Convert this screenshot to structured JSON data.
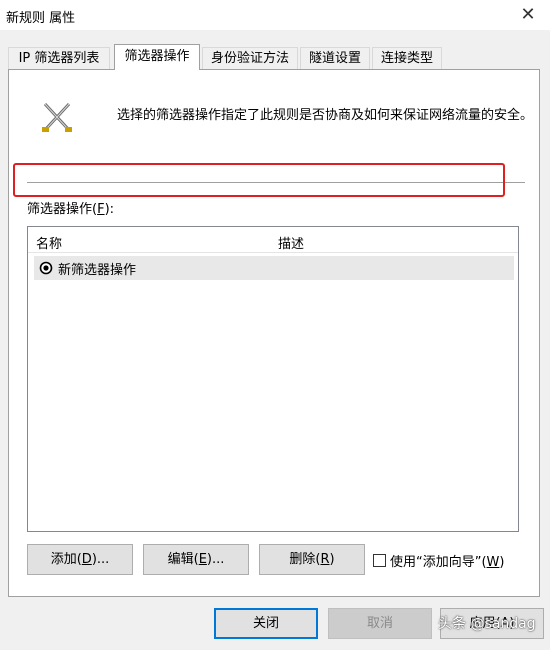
{
  "window": {
    "title": "新规则 属性",
    "close_glyph": "✕"
  },
  "tabs": [
    {
      "label": "IP 筛选器列表",
      "active": false
    },
    {
      "label": "筛选器操作",
      "active": true
    },
    {
      "label": "身份验证方法",
      "active": false
    },
    {
      "label": "隧道设置",
      "active": false
    },
    {
      "label": "连接类型",
      "active": false
    }
  ],
  "panel": {
    "icon": "crossed-swords-icon",
    "description": "选择的筛选器操作指定了此规则是否协商及如何来保证网络流量的安全。",
    "filter_label_prefix": "筛选器操作(",
    "filter_label_key": "F",
    "filter_label_suffix": "):",
    "columns": {
      "name": "名称",
      "desc": "描述"
    },
    "rows": [
      {
        "name": "新筛选器操作",
        "selected": true
      }
    ],
    "buttons": {
      "add": {
        "prefix": "添加(",
        "key": "D",
        "suffix": ")..."
      },
      "edit": {
        "prefix": "编辑(",
        "key": "E",
        "suffix": ")..."
      },
      "delete": {
        "prefix": "删除(",
        "key": "R",
        "suffix": ")"
      }
    },
    "wizard": {
      "prefix": "使用“添加向导”(",
      "key": "W",
      "suffix": ")",
      "checked": false
    }
  },
  "footer": {
    "close": "关闭",
    "cancel": "取消",
    "apply": "应用(A)"
  },
  "watermark": "头条 @sandag",
  "colors": {
    "highlight": "#e02020",
    "focus": "#0078d7"
  }
}
